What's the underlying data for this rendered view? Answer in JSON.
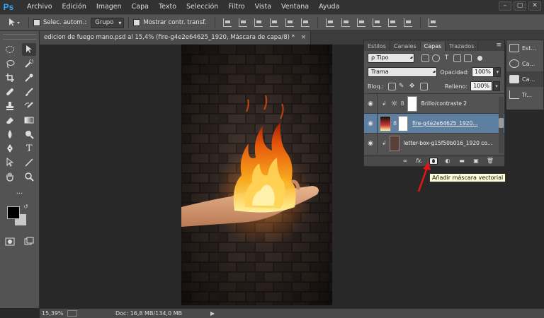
{
  "menubar": {
    "logo": "Ps",
    "items": [
      "Archivo",
      "Edición",
      "Imagen",
      "Capa",
      "Texto",
      "Selección",
      "Filtro",
      "Vista",
      "Ventana",
      "Ayuda"
    ],
    "window_controls": [
      "–",
      "▢",
      "✕"
    ]
  },
  "options": {
    "auto_select_label": "Selec. autom.:",
    "group_value": "Grupo",
    "show_transform_label": "Mostrar contr. transf."
  },
  "document": {
    "tab_title": "edicion de fuego mano.psd al 15,4% (fire-g4e2e64625_1920, Máscara de capa/8) *",
    "close": "×"
  },
  "status": {
    "zoom": "15,39%",
    "doc_info": "Doc: 16,8 MB/134,0 MB",
    "arrow": "▶"
  },
  "layers_panel": {
    "tabs": [
      "Estilos",
      "Canales",
      "Capas",
      "Trazados"
    ],
    "active_tab": "Capas",
    "filter_type": "ρ Tipo",
    "blend_mode": "Trama",
    "opacity_label": "Opacidad:",
    "opacity_value": "100%",
    "lock_label": "Bloq.:",
    "fill_label": "Relleno:",
    "fill_value": "100%",
    "layers": [
      {
        "name": "Brillo/contraste 2",
        "selected": false
      },
      {
        "name": "fire-g4e2e64625_1920...",
        "selected": true
      },
      {
        "name": "letter-box-g15f50b016_1920 co...",
        "selected": false
      }
    ],
    "footer_fx": "fx."
  },
  "tooltip": {
    "text": "Añadir máscara vectorial"
  },
  "right_dock": {
    "items": [
      {
        "label": "Est..."
      },
      {
        "label": "Ca..."
      },
      {
        "label": "Ca..."
      },
      {
        "label": "Tr..."
      }
    ]
  },
  "colors": {
    "accent_selected_layer": "#5d7fa2",
    "ps_logo": "#31a8ff",
    "annotation_arrow": "#e0161a"
  }
}
